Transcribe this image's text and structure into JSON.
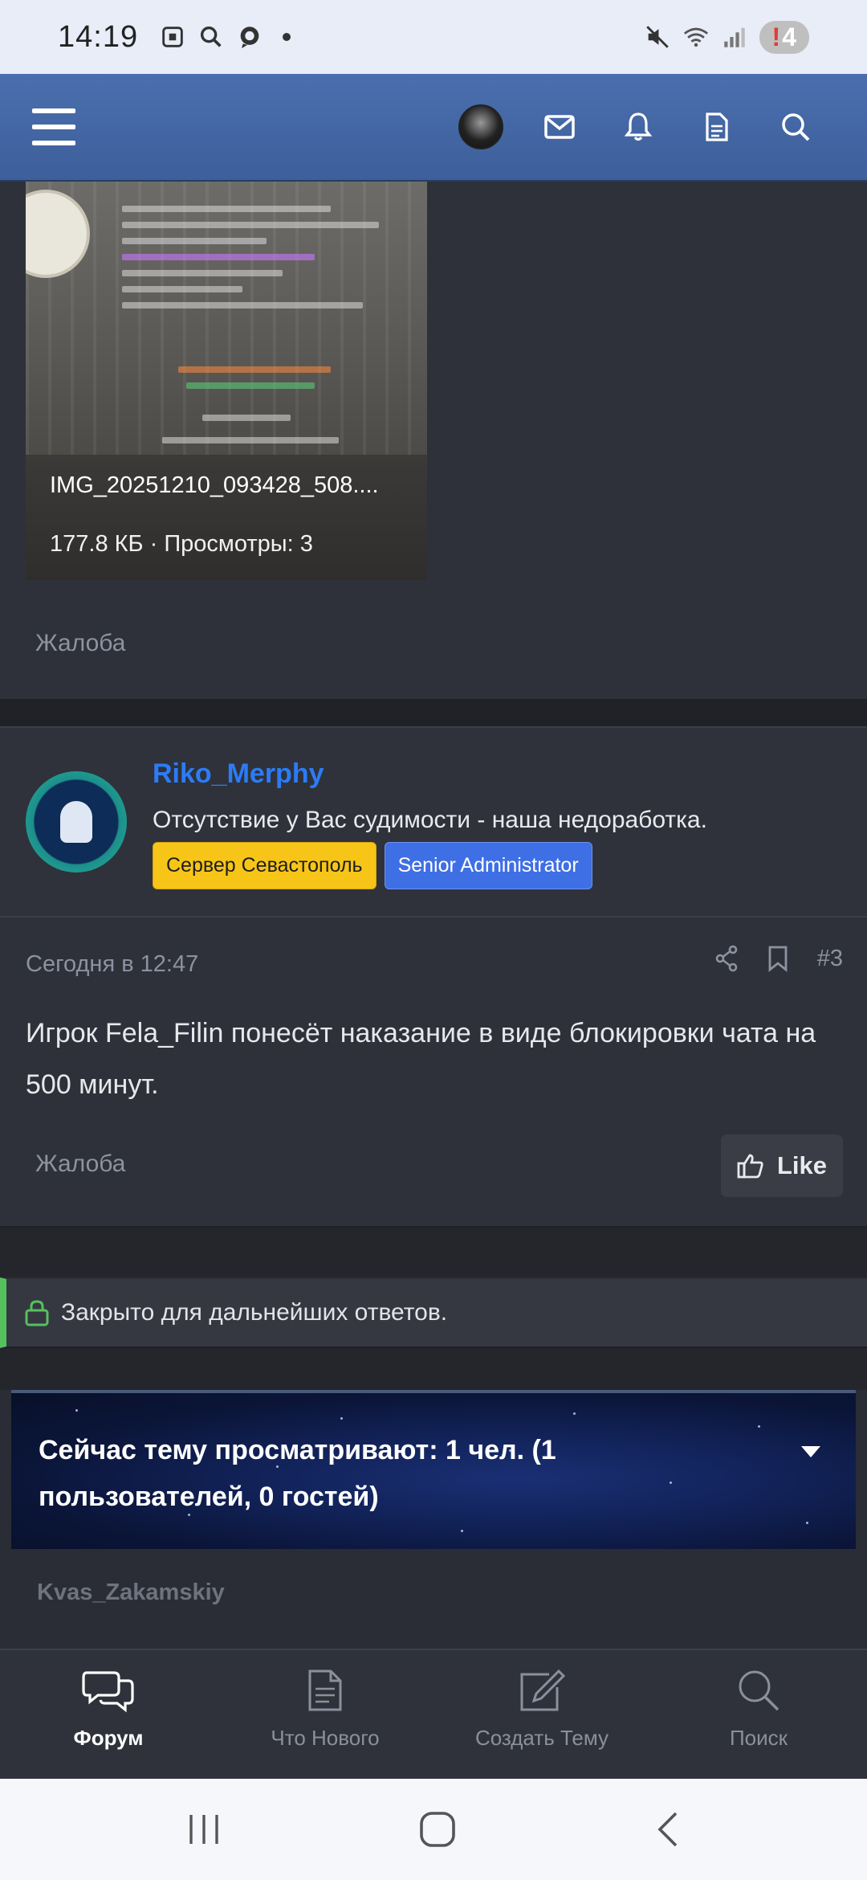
{
  "status_bar": {
    "time": "14:19",
    "battery": "4",
    "battery_alert": "!"
  },
  "top_nav": {
    "icons": [
      "menu-icon",
      "avatar",
      "envelope-icon",
      "bell-icon",
      "document-icon",
      "search-icon"
    ]
  },
  "attachment": {
    "filename": "IMG_20251210_093428_508....",
    "meta": "177.8 КБ · Просмотры: 3",
    "report": "Жалоба"
  },
  "post": {
    "username": "Riko_Merphy",
    "user_title": "Отсутствие у Вас судимости - наша недоработка.",
    "badges": [
      "Сервер Севастополь",
      "Senior Administrator"
    ],
    "date": "Сегодня в 12:47",
    "number": "#3",
    "text": "Игрок Fela_Filin понесёт наказание в виде блокировки чата на 500 минут.",
    "report": "Жалоба",
    "like": "Like"
  },
  "locked_notice": "Закрыто для дальнейших ответов.",
  "viewers": {
    "title": "Сейчас тему просматривают: 1 чел. (1 пользователей, 0 гостей)",
    "users": [
      "Kvas_Zakamskiy"
    ]
  },
  "tab_bar": {
    "tabs": [
      {
        "label": "Форум",
        "icon": "chat-bubbles-icon",
        "active": true
      },
      {
        "label": "Что Нового",
        "icon": "document-icon",
        "active": false
      },
      {
        "label": "Создать Тему",
        "icon": "edit-icon",
        "active": false
      },
      {
        "label": "Поиск",
        "icon": "search-icon",
        "active": false
      }
    ]
  },
  "colors": {
    "nav_bg": "#3d5f9b",
    "username": "#2b7cf6",
    "badge_server": "#f7c518",
    "badge_admin": "#3f6fe4",
    "locked_accent": "#55c15d"
  }
}
